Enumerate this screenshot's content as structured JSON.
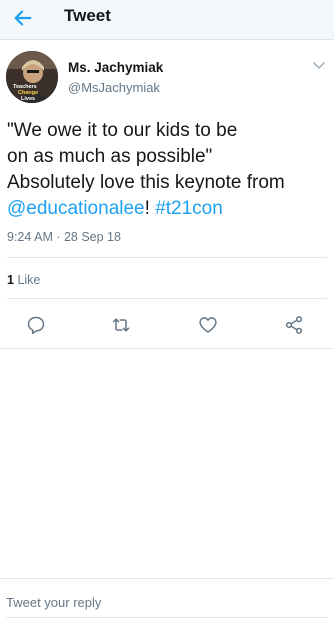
{
  "header": {
    "title": "Tweet",
    "back_icon": "arrow-left-icon"
  },
  "tweet": {
    "author": {
      "name": "Ms. Jachymiak",
      "handle": "@MsJachymiak",
      "avatar_caption": [
        "Teachers",
        "Change",
        "Lives"
      ]
    },
    "text": {
      "line1": "\"We owe it to our kids to be",
      "line2": "on as much as possible\"",
      "line3": "Absolutely love this keynote from",
      "mention": "@educationalee",
      "bang": "!",
      "space": " ",
      "hashtag": "#t21con"
    },
    "timestamp": "9:24 AM · 28 Sep 18",
    "likes": {
      "count": "1",
      "label": "Like"
    },
    "actions": [
      "reply-icon",
      "retweet-icon",
      "heart-icon",
      "share-icon"
    ]
  },
  "reply_bar": {
    "placeholder": "Tweet your reply"
  },
  "colors": {
    "accent": "#1da1f2",
    "secondary_text": "#657786",
    "divider": "#e1e8ed"
  }
}
